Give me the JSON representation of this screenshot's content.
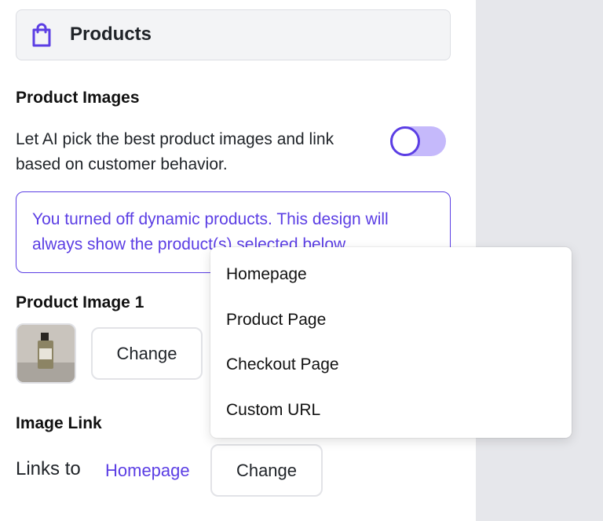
{
  "section": {
    "title": "Products",
    "icon": "shopping-bag-icon"
  },
  "product_images": {
    "heading": "Product Images",
    "description": "Let AI pick the best product images and link based on customer behavior.",
    "toggle_on": false
  },
  "notice": {
    "text": "You turned off dynamic products. This design will always show the product(s) selected below."
  },
  "product_image_1": {
    "heading": "Product Image 1",
    "change_label": "Change"
  },
  "image_link": {
    "heading": "Image Link",
    "links_to_label": "Links to",
    "value": "Homepage",
    "change_label": "Change"
  },
  "dropdown": {
    "options": [
      "Homepage",
      "Product Page",
      "Checkout Page",
      "Custom URL"
    ]
  },
  "colors": {
    "accent": "#5b3ee4",
    "toggle_track": "#c5b9fb"
  }
}
